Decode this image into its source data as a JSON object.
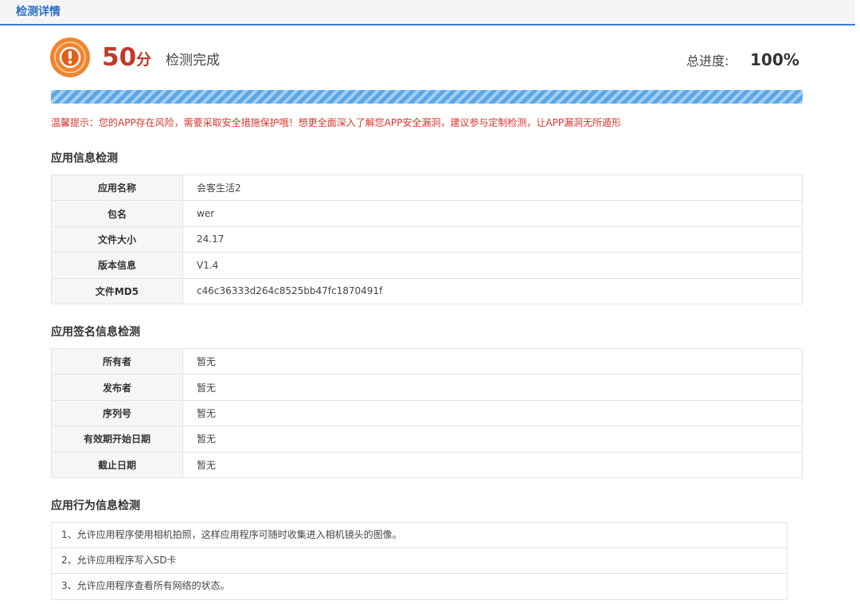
{
  "tab": {
    "title": "检测详情"
  },
  "header": {
    "icon": "warning-target-icon",
    "score": "50",
    "score_unit": "分",
    "status": "检测完成",
    "progress_label": "总进度:",
    "progress_value": "100%",
    "progress_fraction": 1.0
  },
  "warning": "温馨提示：您的APP存在风险，需要采取安全措施保护哦！想更全面深入了解您APP安全漏洞，建议参与定制检测，让APP漏洞无所遁形",
  "app_info": {
    "title": "应用信息检测",
    "rows": [
      {
        "key": "应用名称",
        "value": "会客生活2"
      },
      {
        "key": "包名",
        "value": "wer"
      },
      {
        "key": "文件大小",
        "value": "24.17"
      },
      {
        "key": "版本信息",
        "value": "V1.4"
      },
      {
        "key": "文件MD5",
        "value": "c46c36333d264c8525bb47fc1870491f"
      }
    ]
  },
  "signature_info": {
    "title": "应用签名信息检测",
    "rows": [
      {
        "key": "所有者",
        "value": "暂无"
      },
      {
        "key": "发布者",
        "value": "暂无"
      },
      {
        "key": "序列号",
        "value": "暂无"
      },
      {
        "key": "有效期开始日期",
        "value": "暂无"
      },
      {
        "key": "截止日期",
        "value": "暂无"
      }
    ]
  },
  "behavior_info": {
    "title": "应用行为信息检测",
    "items": [
      "1、允许应用程序使用相机拍照，这样应用程序可随时收集进入相机镜头的图像。",
      "2、允许应用程序写入SD卡",
      "3、允许应用程序查看所有网络的状态。"
    ]
  },
  "colors": {
    "accent": "#2a6ec6",
    "score": "#c0392b",
    "warning": "#d9342b",
    "progress": "#5aa7e8",
    "icon": "#ef7b2a"
  }
}
